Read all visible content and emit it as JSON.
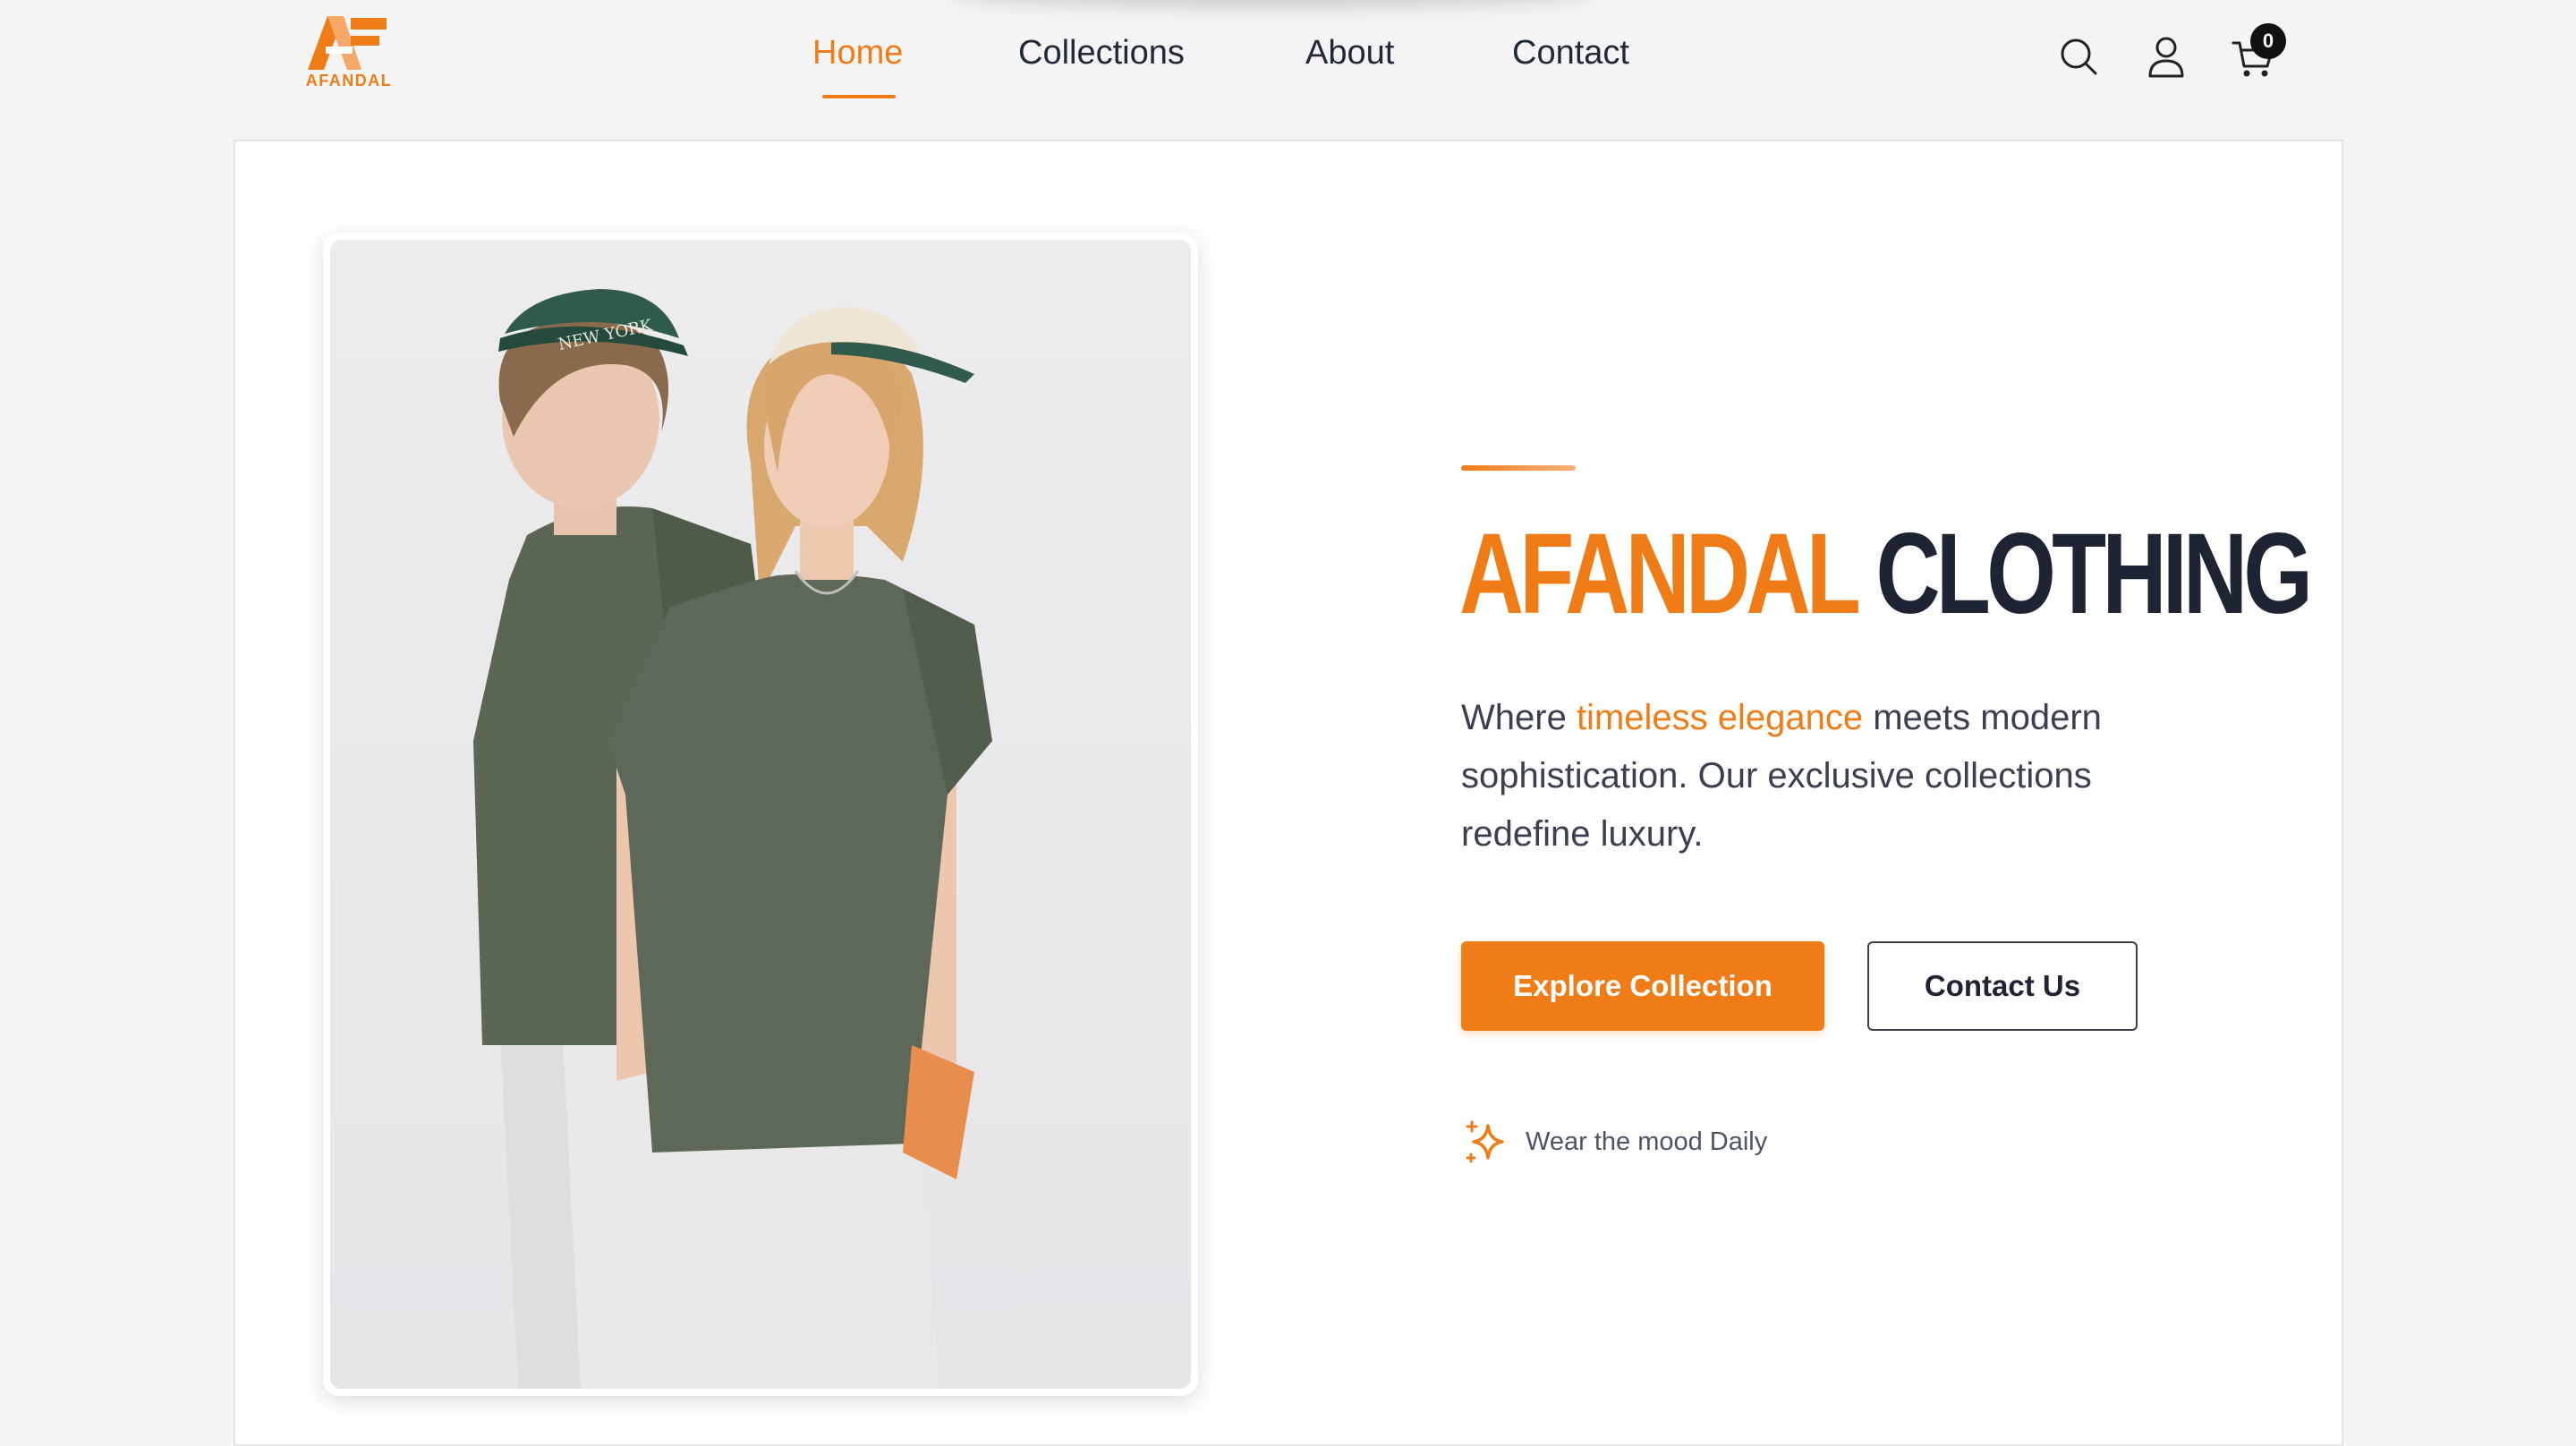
{
  "header": {
    "logo_text": "AFANDAL",
    "nav": [
      {
        "label": "Home",
        "active": true
      },
      {
        "label": "Collections",
        "active": false
      },
      {
        "label": "About",
        "active": false
      },
      {
        "label": "Contact",
        "active": false
      }
    ],
    "icons": [
      "search-icon",
      "user-icon",
      "cart-icon"
    ],
    "cart_count": "0"
  },
  "hero": {
    "title_part1": "AFANDAL",
    "title_part2": "CLOTHING",
    "desc_before": "Where ",
    "desc_highlight": "timeless elegance",
    "desc_after": " meets modern sophistication. Our exclusive collections redefine luxury.",
    "primary_button": "Explore Collection",
    "secondary_button": "Contact Us",
    "tagline": "Wear the mood Daily",
    "tagline_icon": "sparkle-icon",
    "image_alt": "two-models-green-tshirts-caps"
  },
  "colors": {
    "accent": "#f07c17",
    "dark": "#1e2433",
    "background": "#f4f4f4"
  }
}
